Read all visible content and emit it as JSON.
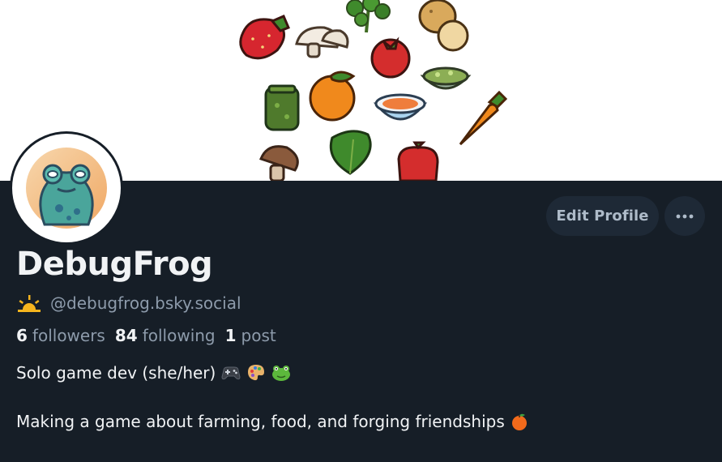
{
  "profile": {
    "display_name": "DebugFrog",
    "handle": "@debugfrog.bsky.social",
    "stats": {
      "followers_count": "6",
      "followers_label": "followers",
      "following_count": "84",
      "following_label": "following",
      "posts_count": "1",
      "posts_label": "post"
    },
    "bio_line_1": "Solo game dev (she/her)",
    "bio_line_2": "Making a game about farming, food, and forging friendships"
  },
  "actions": {
    "edit_profile_label": "Edit Profile",
    "more_label": "⋯"
  },
  "icons": {
    "handle_badge": "sunrise-icon",
    "bio_line_1_emojis": [
      "game-controller-icon",
      "palette-icon",
      "frog-icon"
    ],
    "bio_line_2_emojis": [
      "tangerine-icon"
    ]
  },
  "colors": {
    "background": "#161e27",
    "button_background": "#1e2936",
    "primary_text": "#f1f3f5",
    "secondary_text": "#8d9bab",
    "banner_background": "#ffffff"
  }
}
